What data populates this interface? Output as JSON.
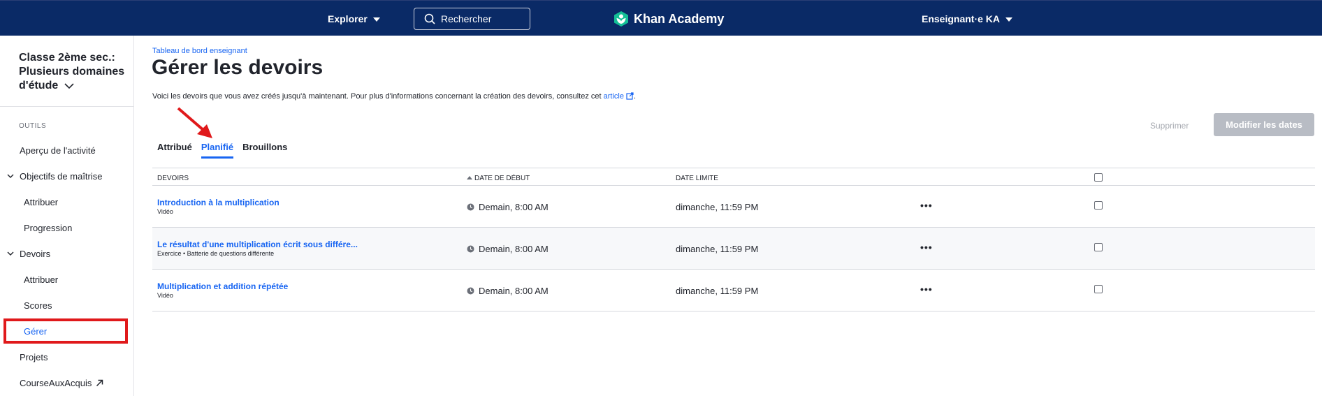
{
  "topbar": {
    "explore_label": "Explorer",
    "search_placeholder": "Rechercher",
    "brand": "Khan Academy",
    "user_label": "Enseignant·e KA"
  },
  "sidebar": {
    "class_title": "Classe 2ème sec.: Plusieurs domaines d'étude",
    "section_label": "OUTILS",
    "items": {
      "activity": "Aperçu de l'activité",
      "mastery": "Objectifs de maîtrise",
      "mastery_assign": "Attribuer",
      "mastery_progress": "Progression",
      "assignments": "Devoirs",
      "assign": "Attribuer",
      "scores": "Scores",
      "manage": "Gérer",
      "projects": "Projets",
      "course_challenge": "CourseAuxAcquis"
    }
  },
  "main": {
    "breadcrumb": "Tableau de bord enseignant",
    "title": "Gérer les devoirs",
    "intro_text": "Voici les devoirs que vous avez créés jusqu'à maintenant. Pour plus d'informations concernant la création des devoirs, consultez cet",
    "intro_link": "article",
    "intro_end": ".",
    "tabs": [
      "Attribué",
      "Planifié",
      "Brouillons"
    ],
    "active_tab": "Planifié",
    "delete_label": "Supprimer",
    "modify_dates_label": "Modifier les dates",
    "table": {
      "headers": {
        "assignments": "DEVOIRS",
        "start": "DATE DE DÉBUT",
        "due": "DATE LIMITE"
      },
      "rows": [
        {
          "title": "Introduction à la multiplication",
          "type": "Vidéo",
          "start": "Demain, 8:00 AM",
          "due": "dimanche, 11:59 PM",
          "more": "•••"
        },
        {
          "title": "Le résultat d'une multiplication écrit sous différe...",
          "type": "Exercice • Batterie de questions différente",
          "start": "Demain, 8:00 AM",
          "due": "dimanche, 11:59 PM",
          "more": "•••"
        },
        {
          "title": "Multiplication et addition répétée",
          "type": "Vidéo",
          "start": "Demain, 8:00 AM",
          "due": "dimanche, 11:59 PM",
          "more": "•••"
        }
      ]
    }
  },
  "colors": {
    "topbar": "#0a2a66",
    "link_blue": "#1865f2",
    "annotation_red": "#e0191b",
    "disabled_button": "#b8bcc4",
    "logo_green": "#14bf96"
  }
}
